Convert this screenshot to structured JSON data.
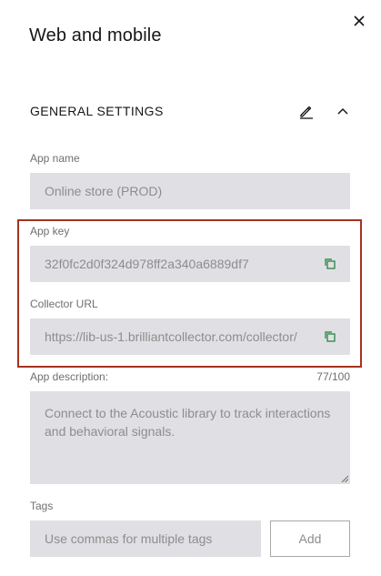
{
  "panel": {
    "title": "Web and mobile",
    "close_icon": "close-icon"
  },
  "section": {
    "header": "GENERAL SETTINGS",
    "edit_icon": "pencil-icon",
    "collapse_icon": "chevron-up-icon"
  },
  "fields": {
    "app_name": {
      "label": "App name",
      "value": "Online store (PROD)"
    },
    "app_key": {
      "label": "App key",
      "value": "32f0fc2d0f324d978ff2a340a6889df7",
      "copy_icon": "copy-icon"
    },
    "collector_url": {
      "label": "Collector URL",
      "value": "https://lib-us-1.brilliantcollector.com/collector/",
      "copy_icon": "copy-icon"
    },
    "app_description": {
      "label": "App description:",
      "counter": "77/100",
      "value": "Connect to the Acoustic library to track interactions and behavioral signals."
    },
    "tags": {
      "label": "Tags",
      "placeholder": "Use commas for multiple tags",
      "add_label": "Add"
    }
  },
  "colors": {
    "highlight_border": "#a5331f",
    "field_background": "#e0e0e4",
    "copy_icon": "#198038"
  }
}
